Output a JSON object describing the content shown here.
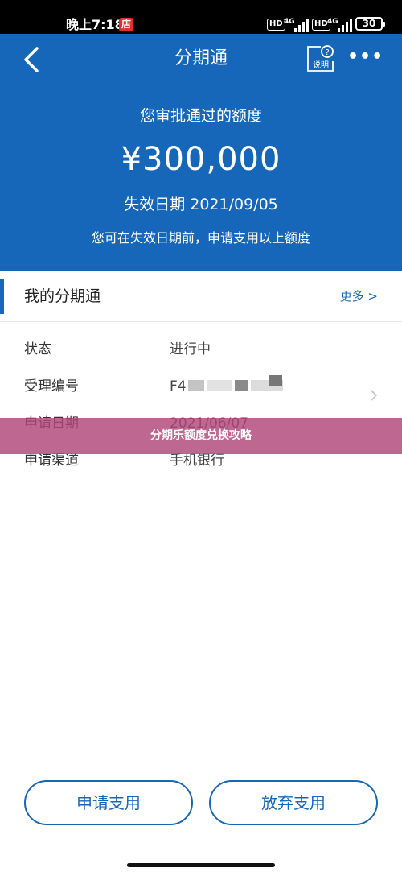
{
  "status_bar": {
    "time": "晚上7:18",
    "badge": "店",
    "hd1": "HD",
    "net1": "4G",
    "hd2": "HD",
    "net2": "4G",
    "battery": "30"
  },
  "nav": {
    "title": "分期通",
    "help_label": "说明",
    "more_icon": "more-dots-icon",
    "back_icon": "back-chevron-icon"
  },
  "summary": {
    "approved_label": "您审批通过的额度",
    "amount": "¥300,000",
    "expiry": "失效日期 2021/09/05",
    "hint": "您可在失效日期前，申请支用以上额度"
  },
  "section": {
    "title": "我的分期通",
    "more_link": "更多 >"
  },
  "details": [
    {
      "label": "状态",
      "value": "进行中"
    },
    {
      "label": "受理编号",
      "value": "F4"
    },
    {
      "label": "申请日期",
      "value": "2021/06/07"
    },
    {
      "label": "申请渠道",
      "value": "手机银行"
    }
  ],
  "overlay": {
    "text": "分期乐额度兑换攻略"
  },
  "actions": {
    "apply": "申请支用",
    "abandon": "放弃支用"
  },
  "colors": {
    "primary": "#1667b9",
    "overlay": "#b04678"
  }
}
